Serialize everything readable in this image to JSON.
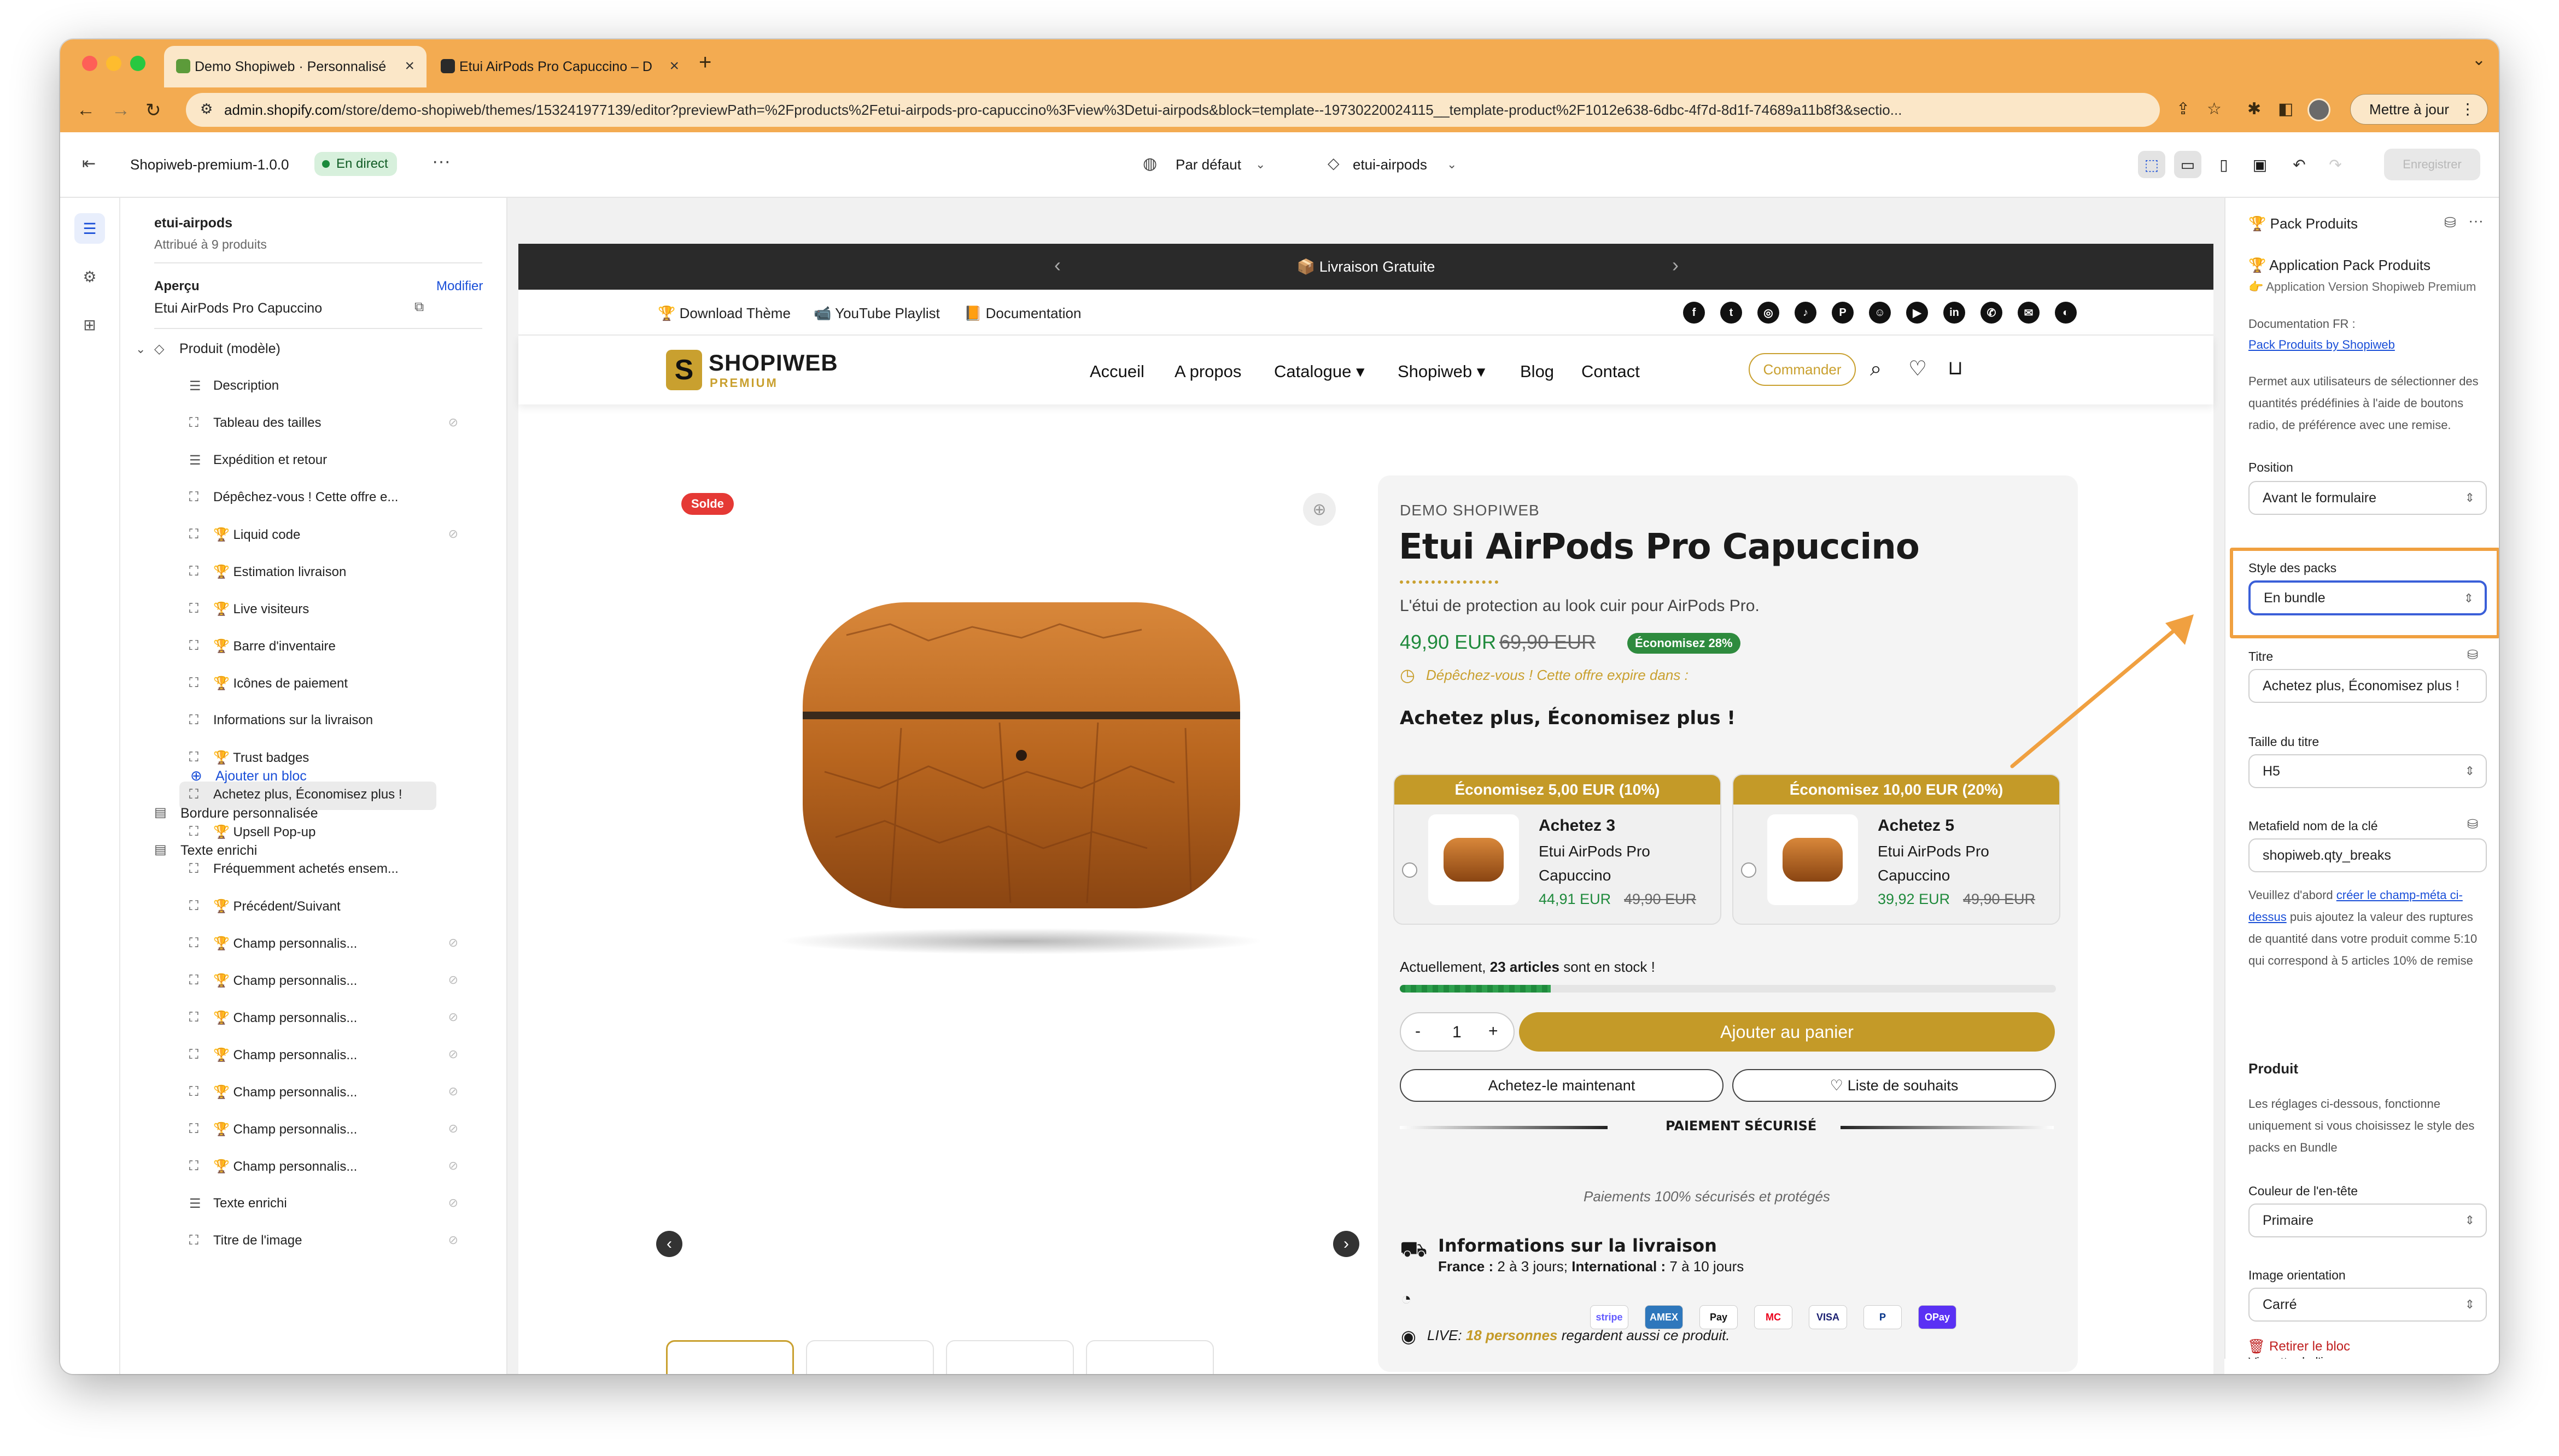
{
  "browser": {
    "tabs": [
      {
        "title": "Demo Shopiweb · Personnalisé",
        "active": true
      },
      {
        "title": "Etui AirPods Pro Capuccino – D",
        "active": false
      }
    ],
    "url_host": "admin.shopify.com",
    "url_path": "/store/demo-shopiweb/themes/153241977139/editor?previewPath=%2Fproducts%2Fetui-airpods-pro-capuccino%3Fview%3Detui-airpods&block=template--19730220024115__template-product%2F1012e638-6dbc-4f7d-8d1f-74689a11b8f3&sectio...",
    "update_button": "Mettre à jour",
    "accent": "#f3ab51"
  },
  "editor_header": {
    "theme_name": "Shopiweb-premium-1.0.0",
    "status": "En direct",
    "more": "···",
    "market": "Par défaut",
    "template": "etui-airpods",
    "save_button": "Enregistrer"
  },
  "sidebar": {
    "template_title": "etui-airpods",
    "template_sub": "Attribué à 9 produits",
    "preview_label": "Aperçu",
    "preview_modify": "Modifier",
    "preview_product": "Etui AirPods Pro Capuccino",
    "section": "Produit (modèle)",
    "blocks": [
      {
        "label": "Description",
        "icon": "text-icon",
        "hidden": false
      },
      {
        "label": "Tableau des tailles",
        "icon": "app-block-icon",
        "hidden": true
      },
      {
        "label": "Expédition et retour",
        "icon": "text-icon",
        "hidden": false
      },
      {
        "label": "Dépêchez-vous ! Cette offre e...",
        "icon": "app-block-icon",
        "hidden": false
      },
      {
        "label": "🏆 Liquid code",
        "icon": "app-block-icon",
        "hidden": true
      },
      {
        "label": "🏆 Estimation livraison",
        "icon": "app-block-icon",
        "hidden": false
      },
      {
        "label": "🏆 Live visiteurs",
        "icon": "app-block-icon",
        "hidden": false
      },
      {
        "label": "🏆 Barre d'inventaire",
        "icon": "app-block-icon",
        "hidden": false
      },
      {
        "label": "🏆 Icônes de paiement",
        "icon": "app-block-icon",
        "hidden": false
      },
      {
        "label": "Informations sur la livraison",
        "icon": "app-block-icon",
        "hidden": false
      },
      {
        "label": "🏆 Trust badges",
        "icon": "app-block-icon",
        "hidden": false
      },
      {
        "label": "Achetez plus, Économisez plus !",
        "icon": "app-block-icon",
        "hidden": false,
        "selected": true
      },
      {
        "label": "🏆 Upsell Pop-up",
        "icon": "app-block-icon",
        "hidden": false
      },
      {
        "label": "Fréquemment achetés ensem...",
        "icon": "app-block-icon",
        "hidden": false
      },
      {
        "label": "🏆 Précédent/Suivant",
        "icon": "app-block-icon",
        "hidden": false
      },
      {
        "label": "🏆 Champ personnalis...",
        "icon": "app-block-icon",
        "hidden": true
      },
      {
        "label": "🏆 Champ personnalis...",
        "icon": "app-block-icon",
        "hidden": true
      },
      {
        "label": "🏆 Champ personnalis...",
        "icon": "app-block-icon",
        "hidden": true
      },
      {
        "label": "🏆 Champ personnalis...",
        "icon": "app-block-icon",
        "hidden": true
      },
      {
        "label": "🏆 Champ personnalis...",
        "icon": "app-block-icon",
        "hidden": true
      },
      {
        "label": "🏆 Champ personnalis...",
        "icon": "app-block-icon",
        "hidden": true
      },
      {
        "label": "🏆 Champ personnalis...",
        "icon": "app-block-icon",
        "hidden": true
      },
      {
        "label": "Texte enrichi",
        "icon": "text-icon",
        "hidden": true
      },
      {
        "label": "Titre de l'image",
        "icon": "app-block-icon",
        "hidden": true
      }
    ],
    "add_block": "Ajouter un bloc",
    "sections_after": [
      "Bordure personnalisée",
      "Texte enrichi"
    ]
  },
  "store": {
    "announcement": "📦 Livraison Gratuite",
    "top_links": [
      "🏆 Download Thème",
      "📹 YouTube Playlist",
      "📙 Documentation"
    ],
    "logo_main": "SHOPIWEB",
    "logo_sub": "PREMIUM",
    "nav": [
      "Accueil",
      "A propos",
      "Catalogue ▾",
      "Shopiweb ▾",
      "Blog",
      "Contact"
    ],
    "cta": "Commander",
    "sale_badge": "Solde",
    "vendor": "DEMO SHOPIWEB",
    "product_title": "Etui AirPods Pro Capuccino",
    "subtitle": "L'étui de protection au look cuir pour AirPods Pro.",
    "price": "49,90 EUR",
    "compare_price": "69,90 EUR",
    "savings_badge": "Économisez 28%",
    "urgency": "Dépêchez-vous ! Cette offre expire dans :",
    "bundle_title": "Achetez plus, Économisez plus !",
    "offers": [
      {
        "header": "Économisez 5,00 EUR (10%)",
        "qty": "Achetez 3",
        "name": "Etui AirPods Pro Capuccino",
        "price": "44,91 EUR",
        "compare": "49,90 EUR"
      },
      {
        "header": "Économisez 10,00 EUR (20%)",
        "qty": "Achetez 5",
        "name": "Etui AirPods Pro Capuccino",
        "price": "39,92 EUR",
        "compare": "49,90 EUR"
      }
    ],
    "stock_prefix": "Actuellement,",
    "stock_count": "23 articles",
    "stock_suffix": "sont en stock !",
    "stock_fraction": 0.23,
    "qty": "1",
    "add_to_cart": "Ajouter au panier",
    "buy_now": "Achetez-le maintenant",
    "wishlist": "Liste de souhaits",
    "secure_payment": "PAIEMENT SÉCURISÉ",
    "payment_icons": [
      "stripe",
      "AMEX",
      "Pay",
      "MC",
      "VISA",
      "P",
      "OPay"
    ],
    "payments_note": "Paiements 100% sécurisés et protégés",
    "shipping_title": "Informations sur la livraison",
    "shipping_fr_label": "France :",
    "shipping_fr": "2 à 3 jours;",
    "shipping_int_label": "International :",
    "shipping_int": "7 à 10 jours",
    "live_prefix": "LIVE:",
    "live_count": "18 personnes",
    "live_suffix": "regardent aussi ce produit.",
    "brand_color": "#c49a28"
  },
  "settings": {
    "block_name": "🏆 Pack Produits",
    "app_title": "🏆 Application Pack Produits",
    "app_version": "👉 Application Version Shopiweb Premium",
    "doc_label": "Documentation FR :",
    "doc_link": "Pack Produits by Shopiweb",
    "description": "Permet aux utilisateurs de sélectionner des quantités prédéfinies à l'aide de boutons radio, de préférence avec une remise.",
    "position_label": "Position",
    "position_value": "Avant le formulaire",
    "style_label": "Style des packs",
    "style_value": "En bundle",
    "title_label": "Titre",
    "title_value": "Achetez plus, Économisez plus !",
    "title_size_label": "Taille du titre",
    "title_size_value": "H5",
    "metafield_label": "Metafield nom de la clé",
    "metafield_value": "shopiweb.qty_breaks",
    "help_prefix": "Veuillez d'abord",
    "help_link": "créer le champ-méta ci-dessus",
    "help_rest": "puis ajoutez la valeur des ruptures de quantité dans votre produit comme 5:10 qui correspond à 5 articles 10% de remise",
    "product_heading": "Produit",
    "product_note": "Les réglages ci-dessous, fonctionne uniquement si vous choisissez le style des packs en Bundle",
    "header_color_label": "Couleur de l'en-tête",
    "header_color_value": "Primaire",
    "orientation_label": "Image orientation",
    "orientation_value": "Carré",
    "cut_label": "Vignette de l'image",
    "remove_block": "Retirer le bloc",
    "highlight_color": "#f0a040"
  }
}
